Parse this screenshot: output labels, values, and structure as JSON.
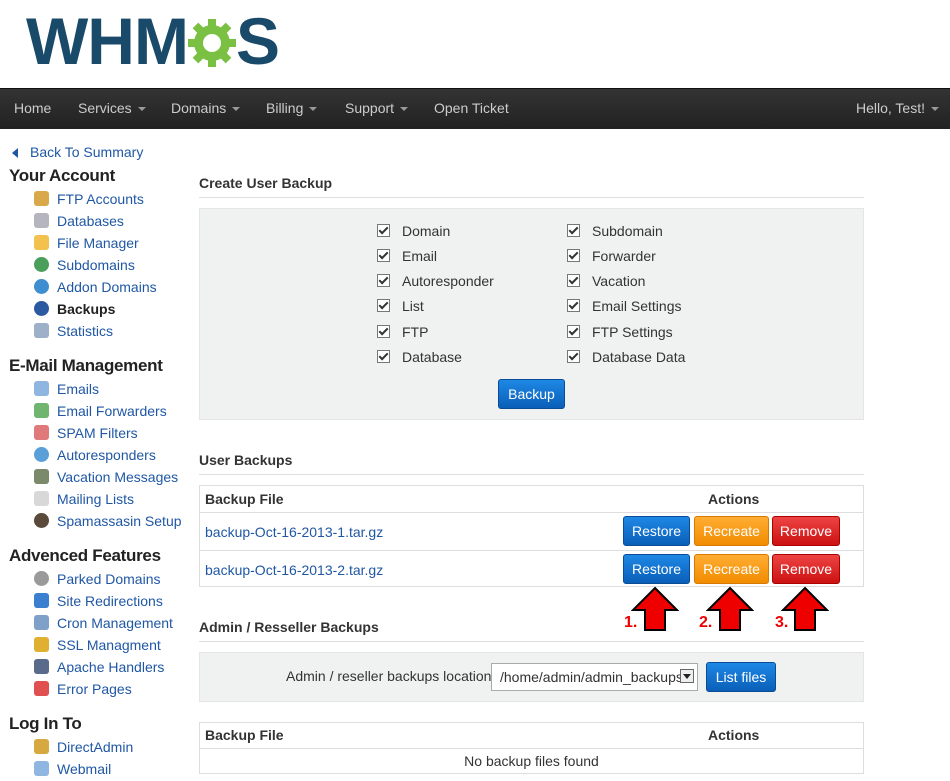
{
  "logo": {
    "text_left": "WHM",
    "text_right": "S",
    "gear_color": "#7ac143"
  },
  "nav": {
    "items": [
      "Home",
      "Services",
      "Domains",
      "Billing",
      "Support",
      "Open Ticket"
    ],
    "user": "Hello, Test!"
  },
  "sidebar": {
    "back": "Back To Summary",
    "sections": [
      {
        "title": "Your Account",
        "items": [
          "FTP Accounts",
          "Databases",
          "File Manager",
          "Subdomains",
          "Addon Domains",
          "Backups",
          "Statistics"
        ]
      },
      {
        "title": "E-Mail Management",
        "items": [
          "Emails",
          "Email Forwarders",
          "SPAM Filters",
          "Autoresponders",
          "Vacation Messages",
          "Mailing Lists",
          "Spamassasin Setup"
        ]
      },
      {
        "title": "Advenced Features",
        "items": [
          "Parked Domains",
          "Site Redirections",
          "Cron Management",
          "SSL Managment",
          "Apache Handlers",
          "Error Pages"
        ]
      },
      {
        "title": "Log In To",
        "items": [
          "DirectAdmin",
          "Webmail"
        ]
      }
    ],
    "active": "Backups"
  },
  "create_backup": {
    "title": "Create User Backup",
    "left": [
      "Domain",
      "Email",
      "Autoresponder",
      "List",
      "FTP",
      "Database"
    ],
    "right": [
      "Subdomain",
      "Forwarder",
      "Vacation",
      "Email Settings",
      "FTP Settings",
      "Database Data"
    ],
    "button": "Backup"
  },
  "user_backups": {
    "title": "User Backups",
    "col_file": "Backup File",
    "col_actions": "Actions",
    "rows": [
      "backup-Oct-16-2013-1.tar.gz",
      "backup-Oct-16-2013-2.tar.gz"
    ],
    "restore": "Restore",
    "recreate": "Recreate",
    "remove": "Remove"
  },
  "annotations": [
    "1.",
    "2.",
    "3."
  ],
  "admin_backups": {
    "title": "Admin / Resseller Backups",
    "location_label": "Admin / reseller backups location:",
    "location_value": "/home/admin/admin_backups",
    "list_button": "List files",
    "col_file": "Backup File",
    "col_actions": "Actions",
    "empty": "No backup files found"
  }
}
